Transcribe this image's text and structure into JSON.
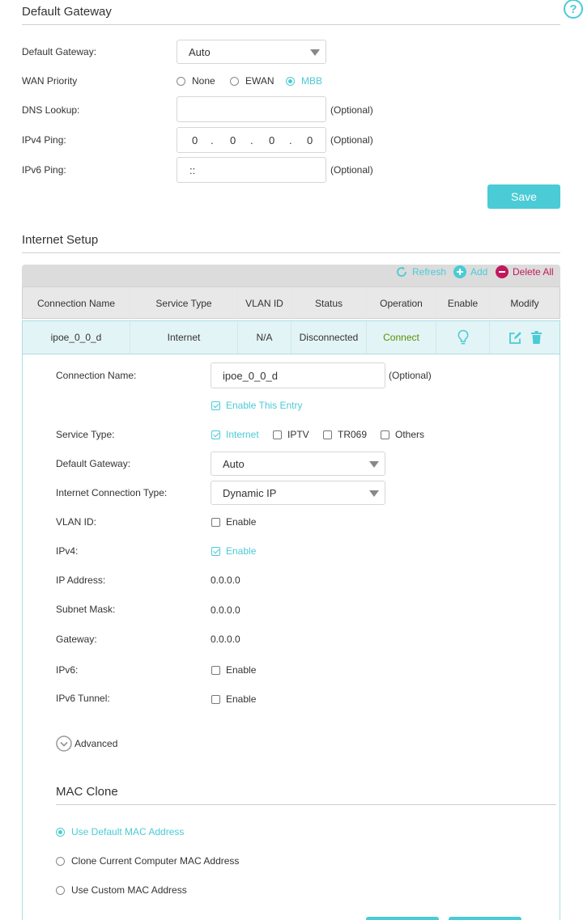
{
  "help": {
    "icon": "help-icon"
  },
  "default_gateway_section": {
    "title": "Default Gateway",
    "gateway_label": "Default Gateway:",
    "gateway_value": "Auto",
    "wan_priority_label": "WAN Priority",
    "wan_options": [
      "None",
      "EWAN",
      "MBB"
    ],
    "wan_selected": "MBB",
    "dns_label": "DNS Lookup:",
    "dns_value": "",
    "dns_hint": "(Optional)",
    "ipv4_ping_label": "IPv4 Ping:",
    "ipv4_octets": [
      "0",
      "0",
      "0",
      "0"
    ],
    "ipv4_dot": ".",
    "ipv4_hint": "(Optional)",
    "ipv6_ping_label": "IPv6 Ping:",
    "ipv6_value": "::",
    "ipv6_hint": "(Optional)",
    "save_label": "Save"
  },
  "internet_setup": {
    "title": "Internet Setup",
    "toolbar": {
      "refresh": "Refresh",
      "add": "Add",
      "delete_all": "Delete All"
    },
    "columns": [
      "Connection Name",
      "Service Type",
      "VLAN ID",
      "Status",
      "Operation",
      "Enable",
      "Modify"
    ],
    "row": {
      "name": "ipoe_0_0_d",
      "service": "Internet",
      "vlan": "N/A",
      "status": "Disconnected",
      "operation": "Connect"
    }
  },
  "edit_form": {
    "conn_name_label": "Connection Name:",
    "conn_name_value": "ipoe_0_0_d",
    "conn_name_hint": "(Optional)",
    "enable_entry": "Enable This Entry",
    "service_type_label": "Service Type:",
    "service_options": [
      "Internet",
      "IPTV",
      "TR069",
      "Others"
    ],
    "default_gateway_label": "Default Gateway:",
    "default_gateway_value": "Auto",
    "ict_label": "Internet Connection Type:",
    "ict_value": "Dynamic IP",
    "vlan_label": "VLAN ID:",
    "vlan_enable": "Enable",
    "ipv4_label": "IPv4:",
    "ipv4_enable": "Enable",
    "ip_label": "IP Address:",
    "ip_value": "0.0.0.0",
    "mask_label": "Subnet Mask:",
    "mask_value": "0.0.0.0",
    "gw_label": "Gateway:",
    "gw_value": "0.0.0.0",
    "ipv6_label": "IPv6:",
    "ipv6_enable": "Enable",
    "tunnel_label": "IPv6 Tunnel:",
    "tunnel_enable": "Enable",
    "advanced": "Advanced"
  },
  "mac_clone": {
    "title": "MAC Clone",
    "options": [
      "Use Default MAC Address",
      "Clone Current Computer MAC Address",
      "Use Custom MAC Address"
    ]
  },
  "colors": {
    "accent": "#4acbd6",
    "delete": "#c2185b",
    "connect": "#5a8f00"
  }
}
